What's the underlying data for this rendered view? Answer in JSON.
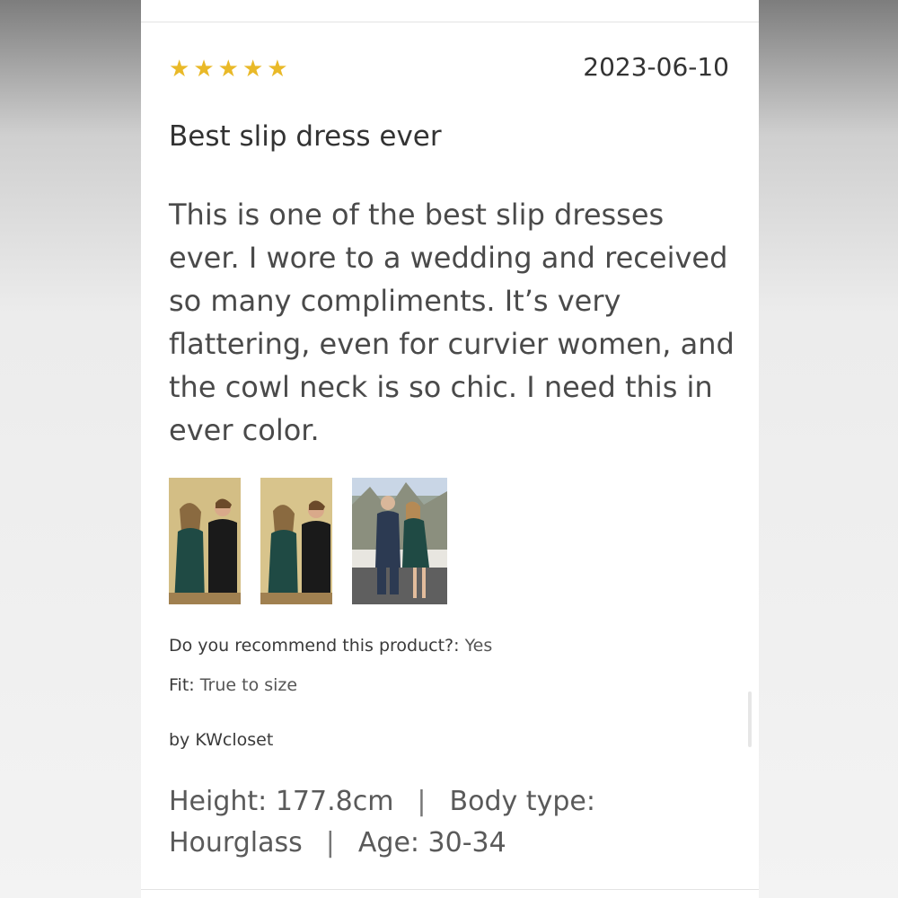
{
  "review": {
    "rating": 5,
    "rating_max": 5,
    "star_color": "#e9b928",
    "date": "2023-06-10",
    "title": "Best slip dress ever",
    "text": "This is one of the best slip dresses ever. I wore to a wedding and received so many compliments. It’s very flattering, even for curvier women, and the cowl neck is so chic. I need this in ever color.",
    "photos": [
      {
        "alt_icon": "photo-thumbnail"
      },
      {
        "alt_icon": "photo-thumbnail"
      },
      {
        "alt_icon": "photo-thumbnail"
      }
    ],
    "recommend_label": "Do you recommend this product?:",
    "recommend_value": "Yes",
    "fit_label": "Fit:",
    "fit_value": "True to size",
    "author": "by KWcloset",
    "height": "Height: 177.8cm",
    "separator": "|",
    "body_type": "Body type: Hourglass",
    "age": "Age: 30-34"
  }
}
